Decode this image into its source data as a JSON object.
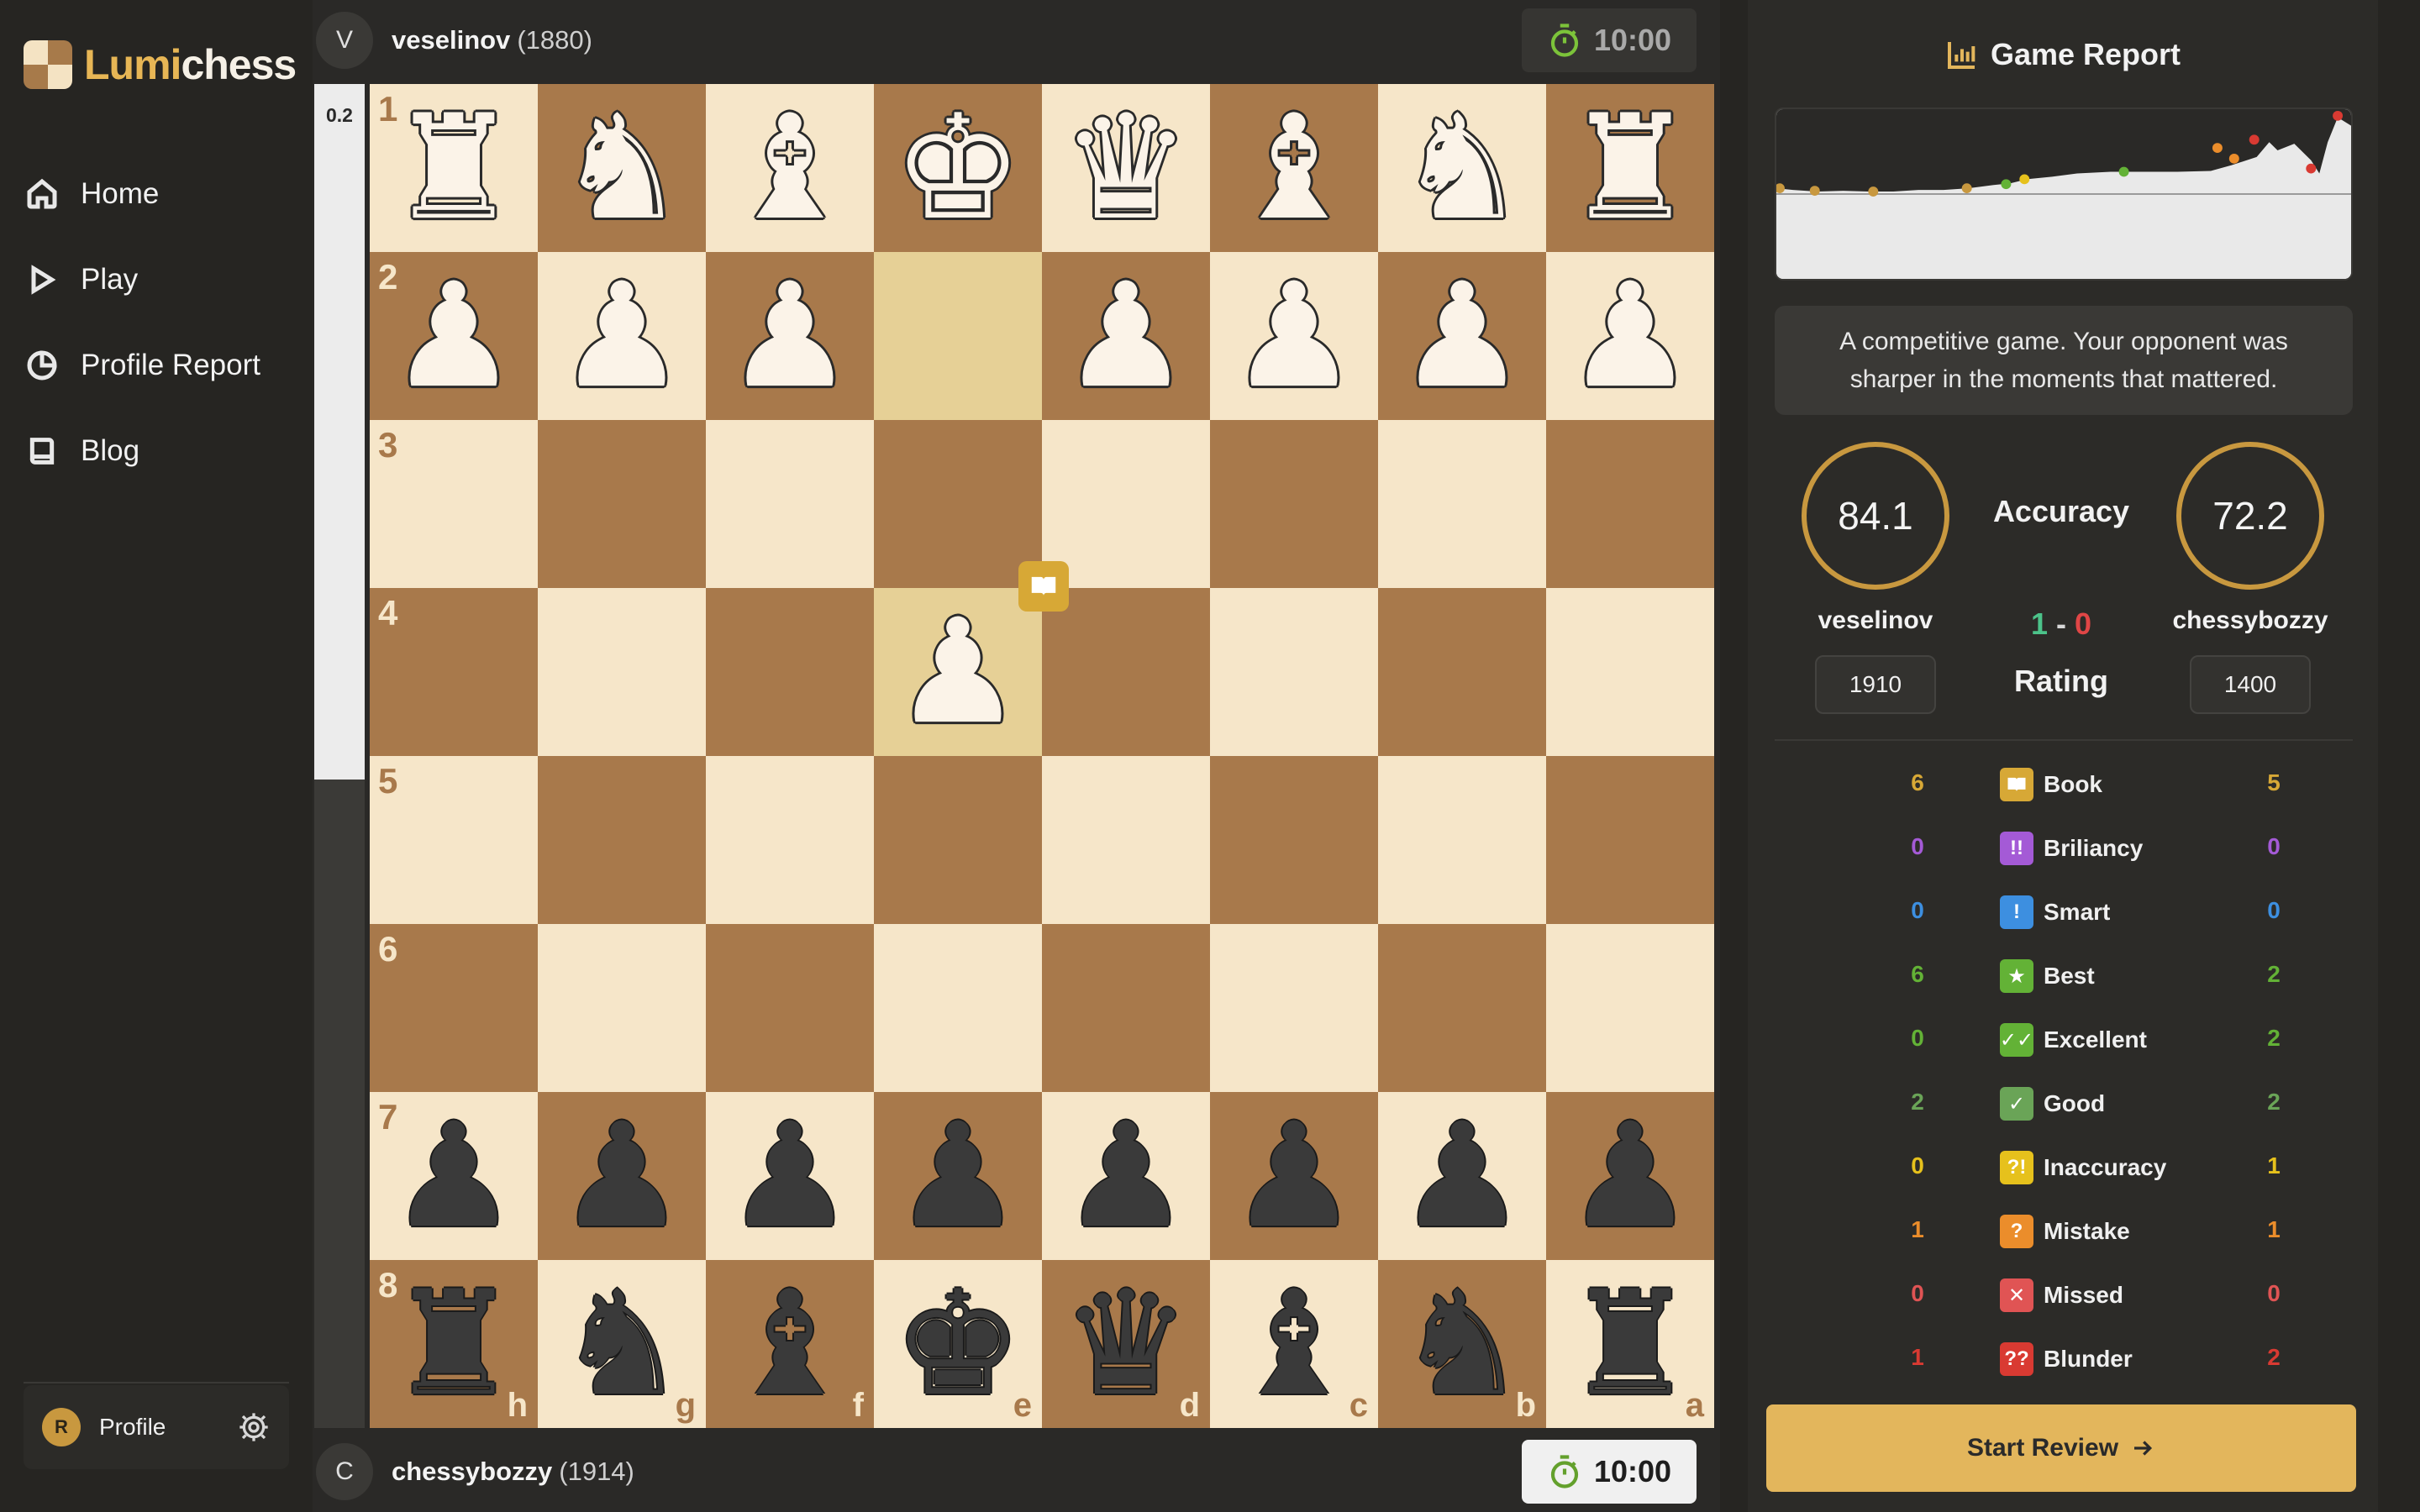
{
  "app": {
    "brand_first": "Lumi",
    "brand_second": "chess",
    "accent_color": "#e3b65c"
  },
  "sidebar": {
    "items": [
      {
        "label": "Home",
        "icon": "home-icon"
      },
      {
        "label": "Play",
        "icon": "play-icon"
      },
      {
        "label": "Profile Report",
        "icon": "pie-chart-icon"
      },
      {
        "label": "Blog",
        "icon": "book-icon"
      }
    ],
    "profile": {
      "avatar_letter": "R",
      "label": "Profile"
    }
  },
  "players": {
    "top": {
      "avatar_letter": "V",
      "name": "veselinov",
      "rating": "(1880)",
      "clock": "10:00"
    },
    "bottom": {
      "avatar_letter": "C",
      "name": "chessybozzy",
      "rating": "(1914)",
      "clock": "10:00"
    }
  },
  "eval_bar": {
    "value": "0.2",
    "white_fraction": 0.52
  },
  "board": {
    "orientation": "black-bottom",
    "ranks": [
      "1",
      "2",
      "3",
      "4",
      "5",
      "6",
      "7",
      "8"
    ],
    "files": [
      "h",
      "g",
      "f",
      "e",
      "d",
      "c",
      "b",
      "a"
    ],
    "highlighted_squares": [
      "e2",
      "e4"
    ],
    "last_move_badge": "book-icon",
    "rows": [
      [
        "wR",
        "wN",
        "wB",
        "wK",
        "wQ",
        "wB",
        "wN",
        "wR"
      ],
      [
        "wP",
        "wP",
        "wP",
        "",
        "wP",
        "wP",
        "wP",
        "wP"
      ],
      [
        "",
        "",
        "",
        "",
        "",
        "",
        "",
        ""
      ],
      [
        "",
        "",
        "",
        "wP",
        "",
        "",
        "",
        ""
      ],
      [
        "",
        "",
        "",
        "",
        "",
        "",
        "",
        ""
      ],
      [
        "",
        "",
        "",
        "",
        "",
        "",
        "",
        ""
      ],
      [
        "bP",
        "bP",
        "bP",
        "bP",
        "bP",
        "bP",
        "bP",
        "bP"
      ],
      [
        "bR",
        "bN",
        "bB",
        "bK",
        "bQ",
        "bB",
        "bN",
        "bR"
      ]
    ]
  },
  "report": {
    "title": "Game Report",
    "summary_line1": "A competitive game. Your opponent was",
    "summary_line2": "sharper in the moments that mattered.",
    "accuracy_label": "Accuracy",
    "white_accuracy": "84.1",
    "black_accuracy": "72.2",
    "white_name": "veselinov",
    "black_name": "chessybozzy",
    "score_white": "1",
    "score_sep": "-",
    "score_black": "0",
    "rating_label": "Rating",
    "white_rating": "1910",
    "black_rating": "1400",
    "stats": [
      {
        "name": "Book",
        "left": "6",
        "right": "5",
        "color": "#d7a836",
        "glyph": "book"
      },
      {
        "name": "Briliancy",
        "left": "0",
        "right": "0",
        "color": "#a45ad6",
        "glyph": "!!"
      },
      {
        "name": "Smart",
        "left": "0",
        "right": "0",
        "color": "#3d8fe0",
        "glyph": "!"
      },
      {
        "name": "Best",
        "left": "6",
        "right": "2",
        "color": "#63b236",
        "glyph": "★"
      },
      {
        "name": "Excellent",
        "left": "0",
        "right": "2",
        "color": "#63b236",
        "glyph": "✓✓"
      },
      {
        "name": "Good",
        "left": "2",
        "right": "2",
        "color": "#6aa457",
        "glyph": "✓"
      },
      {
        "name": "Inaccuracy",
        "left": "0",
        "right": "1",
        "color": "#e6c11c",
        "glyph": "?!"
      },
      {
        "name": "Mistake",
        "left": "1",
        "right": "1",
        "color": "#eb8d2b",
        "glyph": "?"
      },
      {
        "name": "Missed",
        "left": "0",
        "right": "0",
        "color": "#e05454",
        "glyph": "✕"
      },
      {
        "name": "Blunder",
        "left": "1",
        "right": "2",
        "color": "#d93a32",
        "glyph": "??"
      }
    ],
    "start_button": "Start Review"
  }
}
